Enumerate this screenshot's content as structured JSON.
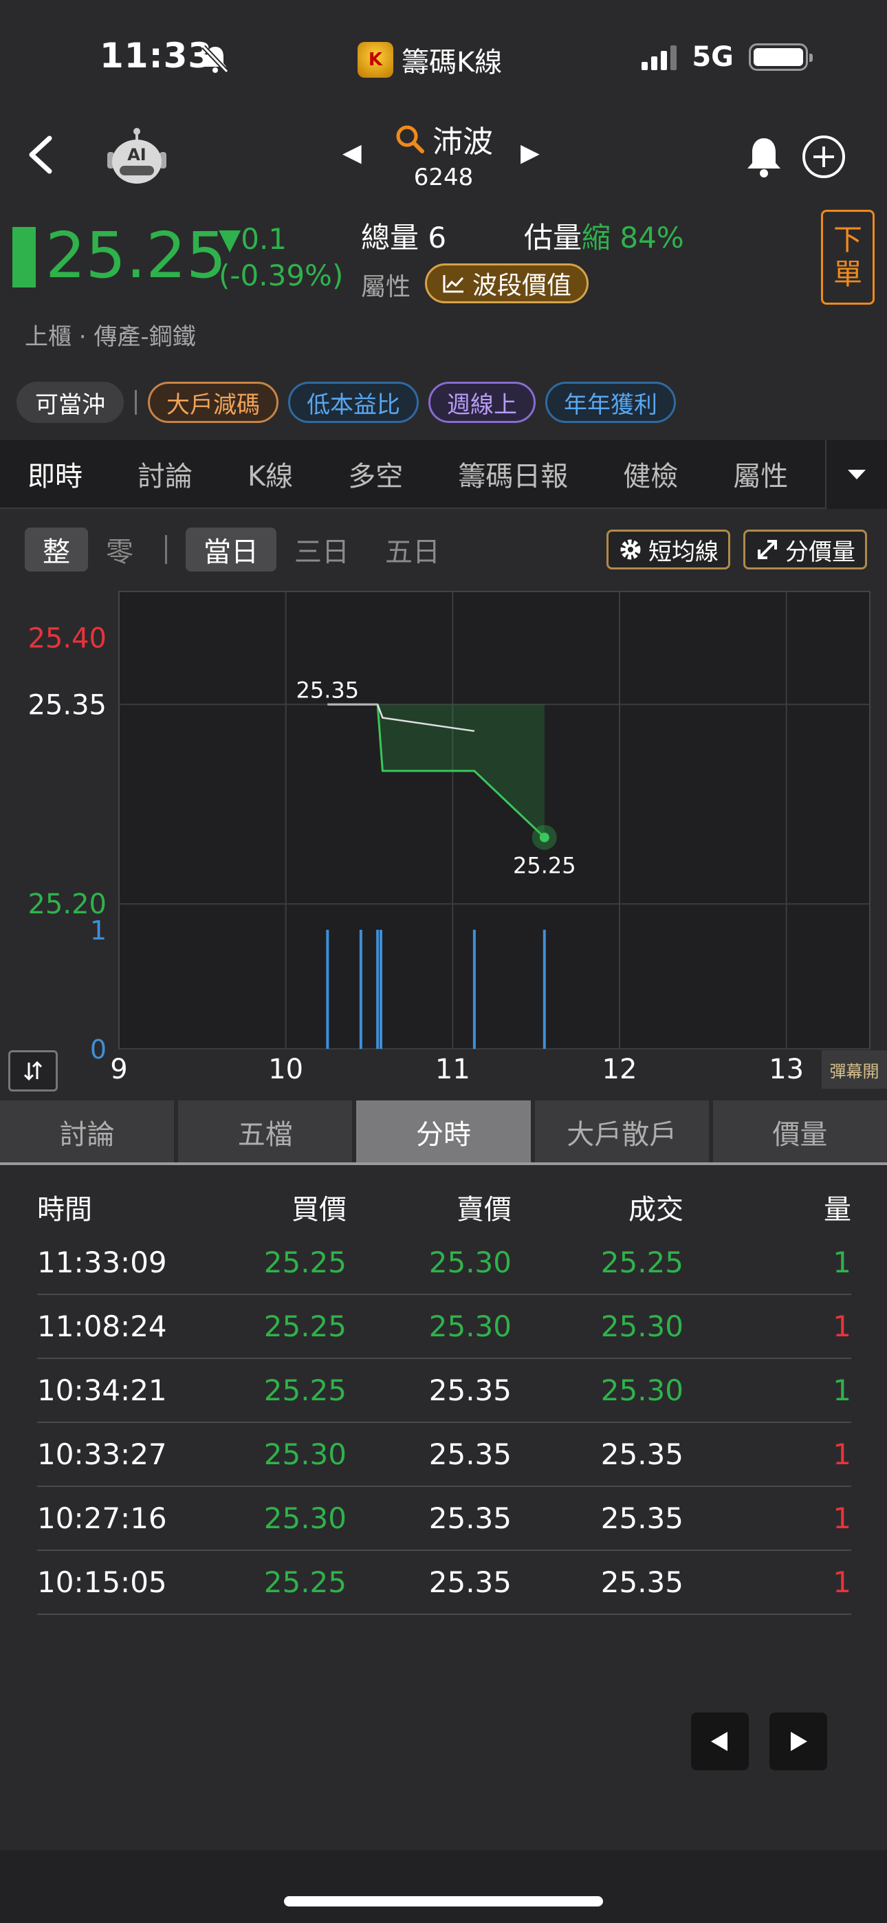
{
  "status": {
    "time": "11:33",
    "app_name": "籌碼K線",
    "app_logo": "K",
    "network": "5G"
  },
  "nav": {
    "stock_name": "沛波",
    "stock_code": "6248",
    "ai_label": "AI",
    "prev": "◀",
    "next": "▶"
  },
  "quote": {
    "price": "25.25",
    "change": "▼0.1",
    "change_pct": "(-0.39%)",
    "volume_label": "總量",
    "volume": "6",
    "est_label": "估量",
    "est_value": "縮 84%",
    "attr_label": "屬性",
    "wave_label": "波段價值",
    "order_label_1": "下",
    "order_label_2": "單",
    "market": "上櫃 · 傳產-鋼鐵",
    "colors": {
      "down": "#2fb24c",
      "up": "#e8333b"
    }
  },
  "tags": [
    "可當沖",
    "大戶減碼",
    "低本益比",
    "週線上",
    "年年獲利"
  ],
  "main_tabs": [
    "即時",
    "討論",
    "K線",
    "多空",
    "籌碼日報",
    "健檢",
    "屬性"
  ],
  "chart_controls": {
    "whole": "整",
    "odd": "零",
    "days": [
      "當日",
      "三日",
      "五日"
    ],
    "ma_btn": "短均線",
    "vol_btn": "分價量",
    "danmaku": "彈幕開"
  },
  "chart_data": {
    "type": "line",
    "x_ticks": [
      "9",
      "10",
      "11",
      "12",
      "13"
    ],
    "price_ticks": {
      "high": "25.40",
      "ref": "25.35",
      "low": "25.20"
    },
    "volume_ticks": [
      "1",
      "0"
    ],
    "price_labels": {
      "start": "25.35",
      "end": "25.25"
    },
    "series": [
      {
        "values": [
          [
            10.25,
            25.35
          ],
          [
            10.55,
            25.35
          ],
          [
            10.58,
            25.3
          ],
          [
            11.13,
            25.3
          ],
          [
            11.55,
            25.25
          ]
        ]
      },
      {
        "values": [
          [
            10.55,
            25.35
          ],
          [
            10.58,
            25.34
          ],
          [
            11.13,
            25.33
          ]
        ]
      }
    ],
    "volume": [
      [
        10.25,
        1
      ],
      [
        10.45,
        1
      ],
      [
        10.55,
        1
      ],
      [
        10.57,
        1
      ],
      [
        11.13,
        1
      ],
      [
        11.55,
        1
      ]
    ],
    "ylim": [
      25.2,
      25.4
    ],
    "xlim": [
      9,
      13.5
    ]
  },
  "sub_tabs": [
    "討論",
    "五檔",
    "分時",
    "大戶散戶",
    "價量"
  ],
  "table": {
    "headers": [
      "時間",
      "買價",
      "賣價",
      "成交",
      "量"
    ],
    "rows": [
      {
        "time": "11:33:09",
        "bid": "25.25",
        "ask": "25.30",
        "deal": "25.25",
        "qty": "1"
      },
      {
        "time": "11:08:24",
        "bid": "25.25",
        "ask": "25.30",
        "deal": "25.30",
        "qty": "1"
      },
      {
        "time": "10:34:21",
        "bid": "25.25",
        "ask": "25.35",
        "deal": "25.30",
        "qty": "1"
      },
      {
        "time": "10:33:27",
        "bid": "25.30",
        "ask": "25.35",
        "deal": "25.35",
        "qty": "1"
      },
      {
        "time": "10:27:16",
        "bid": "25.30",
        "ask": "25.35",
        "deal": "25.35",
        "qty": "1"
      },
      {
        "time": "10:15:05",
        "bid": "25.25",
        "ask": "25.35",
        "deal": "25.35",
        "qty": "1"
      }
    ]
  }
}
